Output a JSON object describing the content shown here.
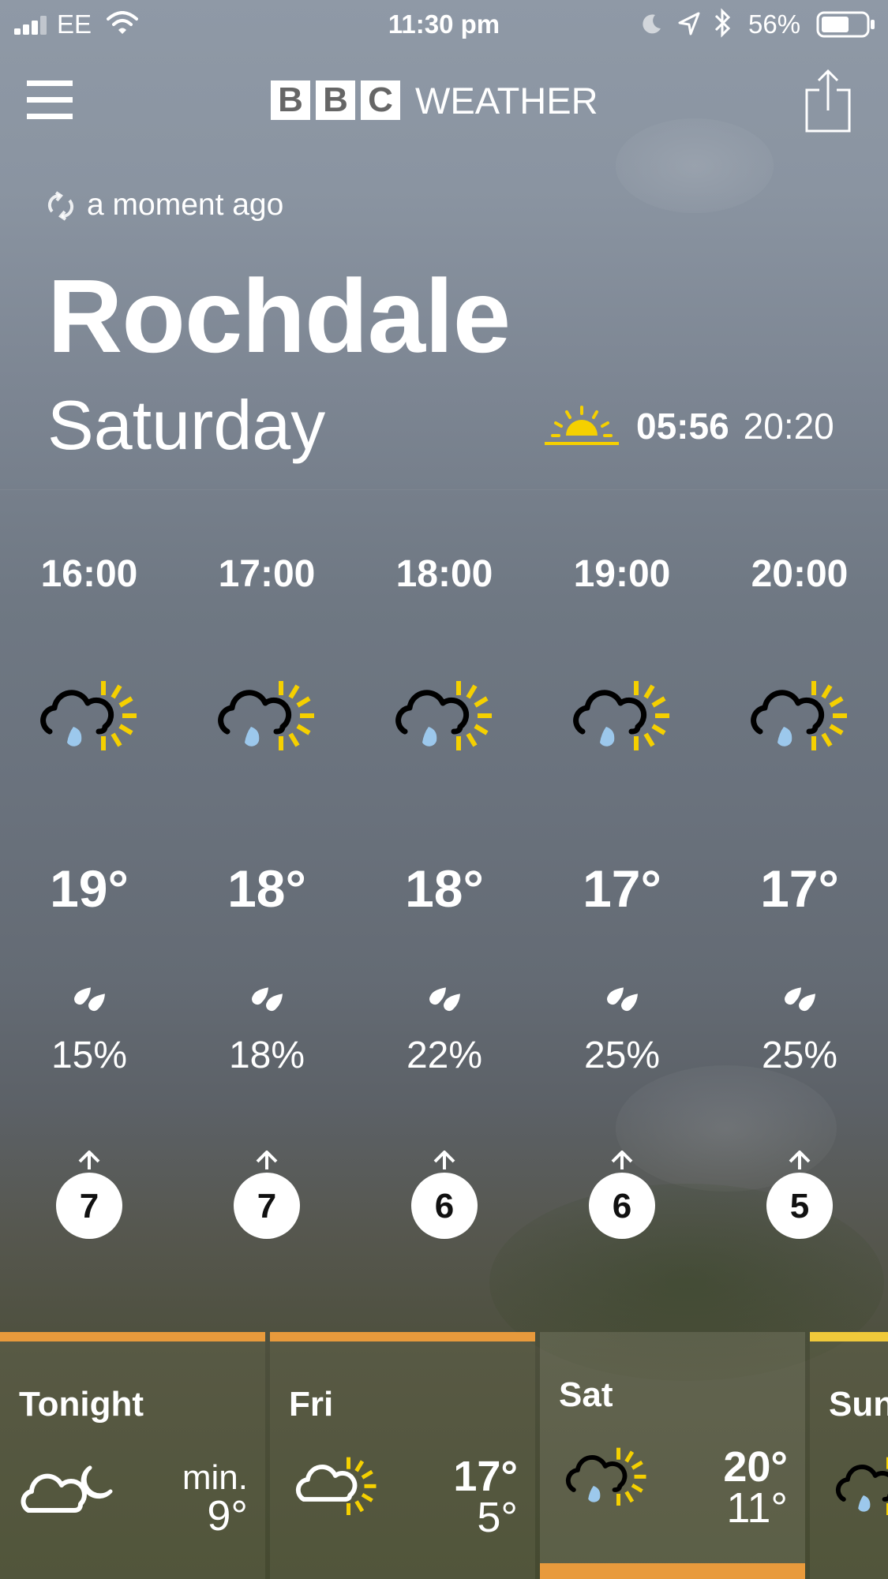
{
  "status_bar": {
    "carrier": "EE",
    "time": "11:30 pm",
    "battery": "56%"
  },
  "header": {
    "logo_letters": [
      "B",
      "B",
      "C"
    ],
    "logo_word": "WEATHER",
    "menu_icon": "hamburger-menu-icon",
    "share_icon": "share-icon"
  },
  "location": {
    "updated": "a moment ago",
    "city": "Rochdale",
    "day": "Saturday",
    "sunrise": "05:56",
    "sunset": "20:20"
  },
  "hourly": [
    {
      "time": "16:00",
      "temp": "19°",
      "rain": "15%",
      "wind": "7",
      "icon": "sunny-intervals-light-rain-icon"
    },
    {
      "time": "17:00",
      "temp": "18°",
      "rain": "18%",
      "wind": "7",
      "icon": "sunny-intervals-light-rain-icon"
    },
    {
      "time": "18:00",
      "temp": "18°",
      "rain": "22%",
      "wind": "6",
      "icon": "sunny-intervals-light-rain-icon"
    },
    {
      "time": "19:00",
      "temp": "17°",
      "rain": "25%",
      "wind": "6",
      "icon": "sunny-intervals-light-rain-icon"
    },
    {
      "time": "20:00",
      "temp": "17°",
      "rain": "25%",
      "wind": "5",
      "icon": "sunny-intervals-light-rain-icon"
    }
  ],
  "daily": [
    {
      "name": "Tonight",
      "min_label": "min.",
      "min": "9°",
      "icon": "partly-cloudy-night-icon"
    },
    {
      "name": "Fri",
      "high": "17°",
      "low": "5°",
      "icon": "sunny-intervals-icon"
    },
    {
      "name": "Sat",
      "high": "20°",
      "low": "11°",
      "icon": "sunny-intervals-light-rain-icon",
      "selected": true
    },
    {
      "name": "Sun",
      "icon": "sunny-intervals-light-rain-icon"
    }
  ],
  "colors": {
    "accent": "#e89a3c",
    "sun": "#f5d000",
    "raindrop": "#9cc8ec",
    "selected_bar": "#f0c93a"
  }
}
